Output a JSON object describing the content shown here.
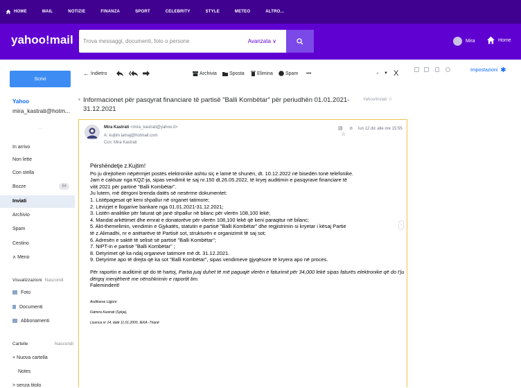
{
  "topnav": {
    "items": [
      "HOME",
      "MAIL",
      "NOTIZIE",
      "FINANZA",
      "SPORT",
      "CELEBRITY",
      "STYLE",
      "METEO",
      "ALTRO..."
    ]
  },
  "header": {
    "logo": "yahoo!mail",
    "search_placeholder": "Trova messaggi, documenti, foto o persone",
    "advanced_label": "Avanzata",
    "user_name": "Mira",
    "home_label": "Home"
  },
  "sidebar": {
    "compose_label": "Scrivi",
    "account_name": "Yahoo",
    "account_email": "mira_kastrati@hotm...",
    "dots": "...",
    "folders": [
      {
        "label": "In arrivo"
      },
      {
        "label": "Non lette"
      },
      {
        "label": "Con stella"
      },
      {
        "label": "Bozze",
        "count": "84"
      },
      {
        "label": "Inviati",
        "active": true
      },
      {
        "label": "Archivio"
      },
      {
        "label": "Spam"
      },
      {
        "label": "Cestino"
      },
      {
        "label": "∧ Meno"
      }
    ],
    "views_header": "Visualizzazioni",
    "views_toggle": "Nascondi",
    "views": [
      "Foto",
      "Documenti",
      "Abbonamenti"
    ],
    "folders_header": "Cartelle",
    "folders_toggle": "Nascondi",
    "new_folder": "+ Nuova cartella",
    "notes": "Notes",
    "untitled": "> senza titolo"
  },
  "toolbar": {
    "back_label": "Indietro",
    "archive": "Archivia",
    "move": "Sposta",
    "delete": "Elimina",
    "spam": "Spam",
    "more": "•••"
  },
  "message": {
    "subject": "Informacionet për pasqyrat financiare të partisë \"Balli Kombëtar\" për periudhën 01.01.2021-31.12.2021",
    "folder": "Yahoo/Inviati",
    "sender_name": "Mira Kastrati",
    "sender_email": "<mira_kastrati@yahoo.it>",
    "to": "A: kujtim.lamaj@hotmail.com",
    "cc": "Ccn: Mira Kastrati",
    "date": "lun 12 dic alle ore 15:55",
    "body": [
      "Përshëndetje z.Kujtim!",
      "Po ju drejtohem nëpërmjet postës elektronike ashtu siç e lamë të shunën, dt. 10.12.2022 në bisedën tonë telefonike.",
      "Jam e caktuar nga KQZ-ja, sipas vendimit te saj nr.150  dt.26.05.2022, të kryej auditimin e pasqyrave financiare të",
      "vitit 2021 për partinë \"Balli Kombëtar\".",
      "Ju lutem, më dërgoni  brenda datës së nesërme dokumentet:",
      "1.   Listëpagesat që keni shpallur në organet tatimore;",
      "2.   Lëvizjet e llogarive bankare nga 01.01.2021-31.12.2021;",
      "3.   Listën analitike për  faturat që janë shpallur në bilanc për vlerën 108,100 lekë;",
      "4.   Mandat arkëtimet dhe emrat e donatorëve për vlerën 108,100 lekë që keni paraqitur në bilanc;",
      "5.   Akt-themelimin, vendimin e Gjykatës, statutin e partisë \"Balli Kombëtar\"  dhe regjistrimin  si kryetar i kësaj Partie",
      "të z.Alimadhi, nr e anëtarëve të Partisë sot, strukturën e organizimit të saj sot;",
      "6.   Adresën e saktë të selisë së partisë \"Balli Kombëtar\";",
      "7.   NIPT-in e partisë \"Balli Kombëtar\" ;",
      "8.   Detyrimet që ka ndaj organeve tatimore më dt. 31.12.2021.",
      "9.   Detyrime apo të drejta që ka sot \"Balli Kombëtar\", sipas vendimeve gjyqësore të kryera apo në proces."
    ],
    "closing_plain": "Për raportin e auditimit që do të hartoj, ",
    "closing_italic": "Partia juaj duhet të më paguajë vlerën e faturimit për 34,000 lekë sipas faturës elektronike që  do t'ju dërgoj menjëherë me nënshkrimin e raportit tim.",
    "thanks": "Faleminderit!",
    "signature": [
      "Audituese Ligjore",
      "Fatmira Kastrati (Sykja),",
      "Licenca nr 14, datë 11.01.2000, IEKA -Tiranë"
    ]
  },
  "rightpanel": {
    "settings_label": "Impostazioni"
  },
  "colors": {
    "topnav_bg": "#400090",
    "header_bg": "#5f01d1",
    "compose_bg": "#3d8cf3",
    "link": "#0f69ff"
  }
}
